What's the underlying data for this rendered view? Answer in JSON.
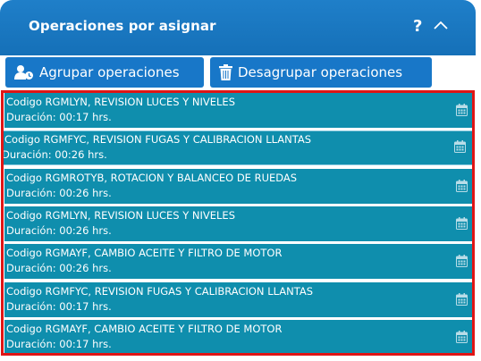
{
  "header": {
    "title": "Operaciones por asignar",
    "help_symbol": "?"
  },
  "toolbar": {
    "group_label": "Agrupar operaciones",
    "ungroup_label": "Desagrupar operaciones"
  },
  "colors": {
    "header": "#1570b8",
    "button": "#1877c8",
    "row": "#0f8ead",
    "highlight": "#e01515"
  },
  "operations": [
    {
      "title": "Codigo RGMLYN, REVISION LUCES Y NIVELES",
      "duration": "Duración: 00:17 hrs."
    },
    {
      "title": "Codigo RGMFYC, REVISION FUGAS Y CALIBRACION LLANTAS",
      "duration": "Duración: 00:26 hrs."
    },
    {
      "title": "Codigo RGMROTYB, ROTACION Y BALANCEO DE RUEDAS",
      "duration": "Duración: 00:26 hrs."
    },
    {
      "title": "Codigo RGMLYN, REVISION LUCES Y NIVELES",
      "duration": "Duración: 00:26 hrs."
    },
    {
      "title": "Codigo RGMAYF, CAMBIO ACEITE Y FILTRO DE MOTOR",
      "duration": "Duración: 00:26 hrs."
    },
    {
      "title": "Codigo RGMFYC, REVISION FUGAS Y CALIBRACION LLANTAS",
      "duration": "Duración: 00:17 hrs."
    },
    {
      "title": "Codigo RGMAYF, CAMBIO ACEITE Y FILTRO DE MOTOR",
      "duration": "Duración: 00:17 hrs."
    }
  ]
}
